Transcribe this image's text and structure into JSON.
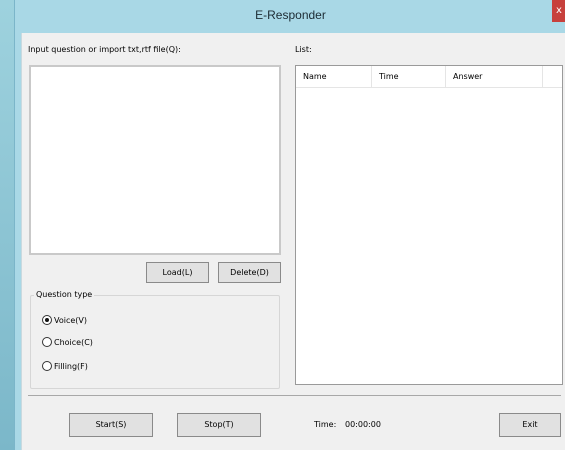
{
  "window": {
    "title": "E-Responder",
    "close_label": "x"
  },
  "question": {
    "label": "Input question or import txt,rtf file(Q):",
    "value": ""
  },
  "buttons": {
    "load": "Load(L)",
    "delete": "Delete(D)",
    "start": "Start(S)",
    "stop": "Stop(T)",
    "exit": "Exit"
  },
  "question_type": {
    "title": "Question type",
    "options": [
      {
        "label": "Voice(V)",
        "checked": true
      },
      {
        "label": "Choice(C)",
        "checked": false
      },
      {
        "label": "Filling(F)",
        "checked": false
      }
    ]
  },
  "list": {
    "label": "List:",
    "columns": [
      "Name",
      "Time",
      "Answer"
    ]
  },
  "status": {
    "time_label": "Time:",
    "time_value": "00:00:00"
  }
}
